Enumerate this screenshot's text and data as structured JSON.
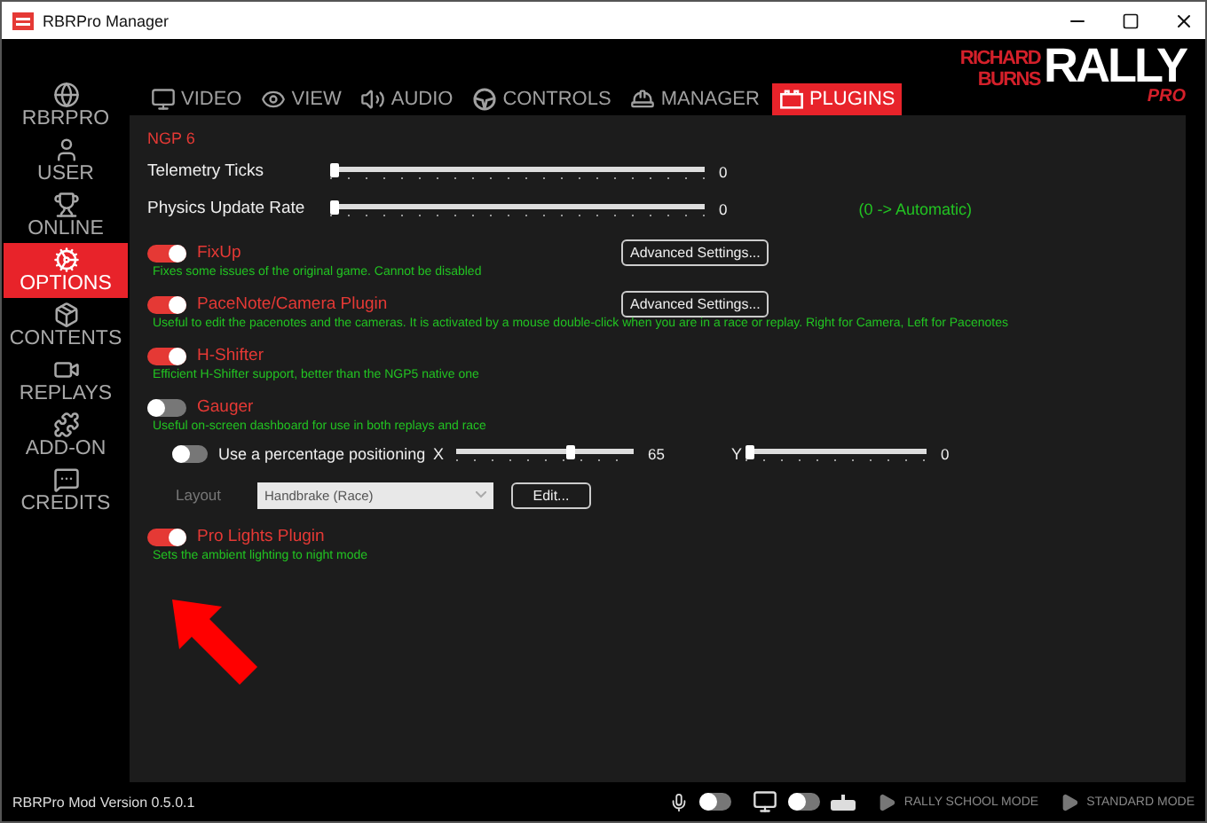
{
  "window": {
    "title": "RBRPro Manager"
  },
  "logo": {
    "line_1": "RICHARD",
    "line_2": "BURNS",
    "main": "RALLY",
    "sub": "PRO"
  },
  "sidebar": {
    "items": [
      {
        "label": "RBRPRO",
        "selected": false
      },
      {
        "label": "USER",
        "selected": false
      },
      {
        "label": "ONLINE",
        "selected": false
      },
      {
        "label": "OPTIONS",
        "selected": true
      },
      {
        "label": "CONTENTS",
        "selected": false
      },
      {
        "label": "REPLAYS",
        "selected": false
      },
      {
        "label": "ADD-ON",
        "selected": false
      },
      {
        "label": "CREDITS",
        "selected": false
      }
    ]
  },
  "tabs": [
    {
      "label": "VIDEO",
      "selected": false
    },
    {
      "label": "VIEW",
      "selected": false
    },
    {
      "label": "AUDIO",
      "selected": false
    },
    {
      "label": "CONTROLS",
      "selected": false
    },
    {
      "label": "MANAGER",
      "selected": false
    },
    {
      "label": "PLUGINS",
      "selected": true
    }
  ],
  "section": {
    "title": "NGP 6",
    "sliders": [
      {
        "label": "Telemetry Ticks",
        "level": 0,
        "reading": "0"
      },
      {
        "label": "Physics Update Rate",
        "level": 0,
        "reading": "0",
        "note": "(0 -> Automatic)"
      }
    ]
  },
  "plugins": [
    {
      "name": "FixUp",
      "on": true,
      "description": "Fixes some issues of the original game. Cannot be disabled",
      "button": "Advanced Settings..."
    },
    {
      "name": "PaceNote/Camera Plugin",
      "on": true,
      "description": "Useful to edit the pacenotes and the cameras. It is activated by a mouse double-click when you are in a race or replay. Right for Camera, Left for Pacenotes",
      "button": "Advanced Settings..."
    },
    {
      "name": "H-Shifter",
      "on": true,
      "description": "Efficient H-Shifter support, better than the NGP5 native one"
    },
    {
      "name": "Gauger",
      "on": false,
      "description": "Useful on-screen dashboard for use in both replays and race",
      "options": {
        "percentage": {
          "label": "Use a percentage positioning",
          "on": false
        },
        "x": {
          "label": "X",
          "level": 0.65,
          "reading": "65"
        },
        "y": {
          "label": "Y",
          "level": 0,
          "reading": "0"
        },
        "layout": {
          "label": "Layout",
          "value": "Handbrake (Race)",
          "disabled": true
        },
        "edit_button": "Edit..."
      }
    },
    {
      "name": "Pro Lights Plugin",
      "on": true,
      "description": "Sets the ambient lighting to night mode"
    }
  ],
  "status_bar": {
    "version": "RBRPro Mod Version 0.5.0.1",
    "mic_on": false,
    "display_toggle_on": false,
    "buttons": [
      "RALLY SCHOOL MODE",
      "STANDARD MODE"
    ]
  }
}
